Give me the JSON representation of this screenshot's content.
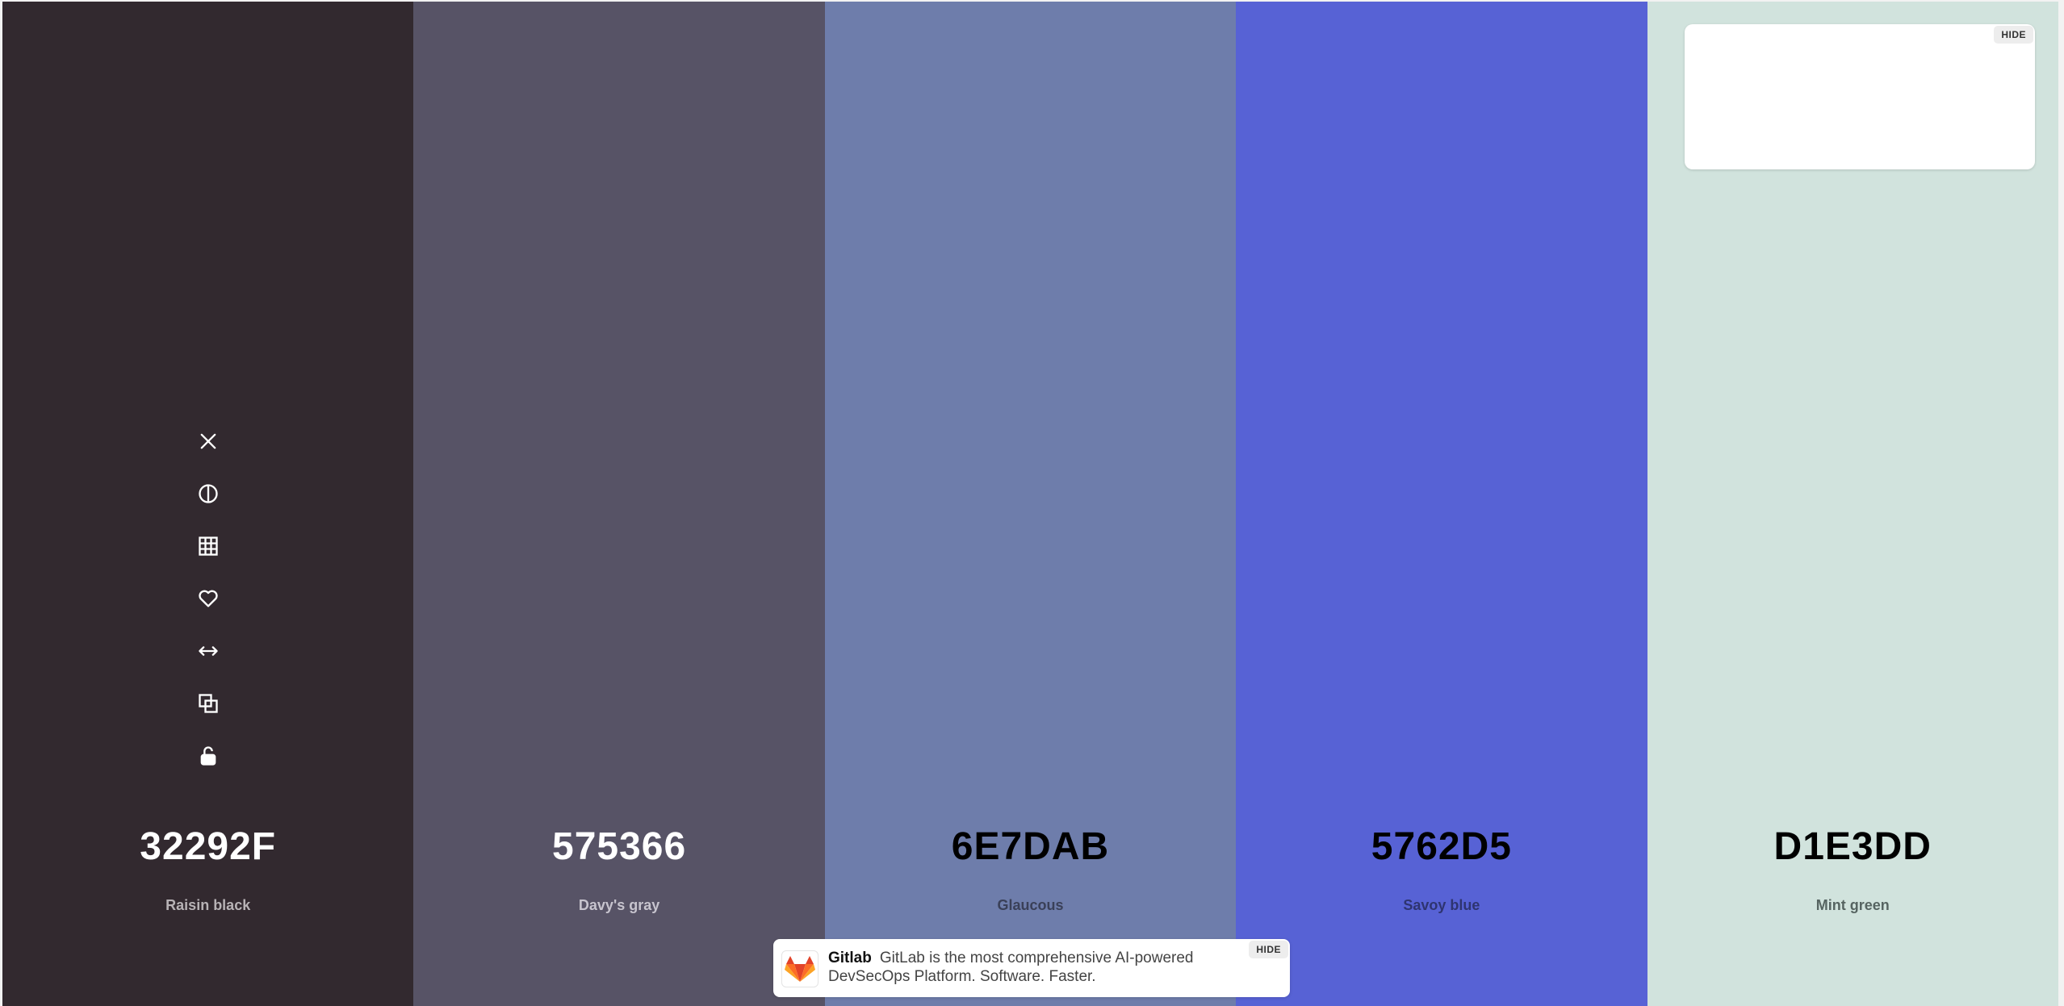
{
  "swatches": [
    {
      "hex": "32292F",
      "name": "Raisin black",
      "bg": "#32292F",
      "hex_color": "#FFFFFF",
      "name_color": "#B8B3B6"
    },
    {
      "hex": "575366",
      "name": "Davy's gray",
      "bg": "#575366",
      "hex_color": "#FFFFFF",
      "name_color": "#C7C4CE"
    },
    {
      "hex": "6E7DAB",
      "name": "Glaucous",
      "bg": "#6E7DAB",
      "hex_color": "#000000",
      "name_color": "#3A4058"
    },
    {
      "hex": "5762D5",
      "name": "Savoy blue",
      "bg": "#5762D5",
      "hex_color": "#000000",
      "name_color": "#2E3470"
    },
    {
      "hex": "D1E3DD",
      "name": "Mint green",
      "bg": "#D1E3DD",
      "hex_color": "#000000",
      "name_color": "#566461"
    }
  ],
  "tools": [
    {
      "icon": "close-icon"
    },
    {
      "icon": "contrast-icon"
    },
    {
      "icon": "shades-grid-icon"
    },
    {
      "icon": "heart-icon"
    },
    {
      "icon": "drag-arrows-icon"
    },
    {
      "icon": "copy-icon"
    },
    {
      "icon": "unlock-icon"
    }
  ],
  "ad_box": {
    "hide_label": "HIDE"
  },
  "notice": {
    "brand": "Gitlab",
    "text": "GitLab is the most comprehensive AI-powered DevSecOps Platform. Software. Faster.",
    "hide_label": "HIDE"
  }
}
